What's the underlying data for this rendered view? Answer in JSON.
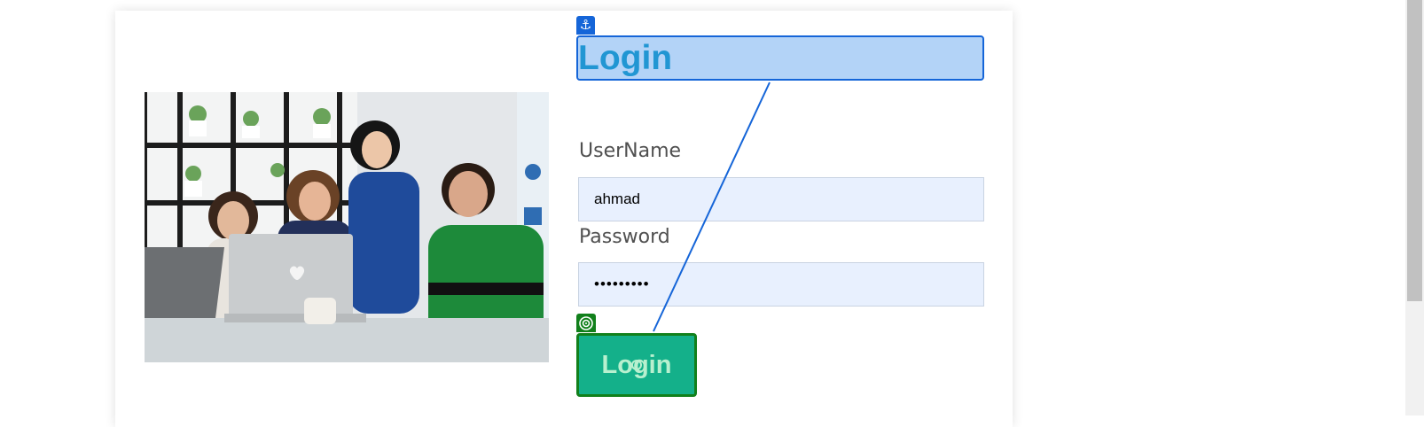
{
  "form": {
    "heading": "Login",
    "username_label": "UserName",
    "username_value": "ahmad",
    "password_label": "Password",
    "password_value": "•••••••••",
    "login_button": "Login"
  },
  "overlay": {
    "anchor_icon": "anchor-icon",
    "target_icon": "target-icon",
    "anchor_color": "#1565d8",
    "target_color": "#11801b"
  },
  "colors": {
    "heading_text": "#2196d3",
    "heading_fill": "#b3d3f7",
    "input_fill": "#e8f0fe",
    "button_fill": "#14b08a"
  }
}
